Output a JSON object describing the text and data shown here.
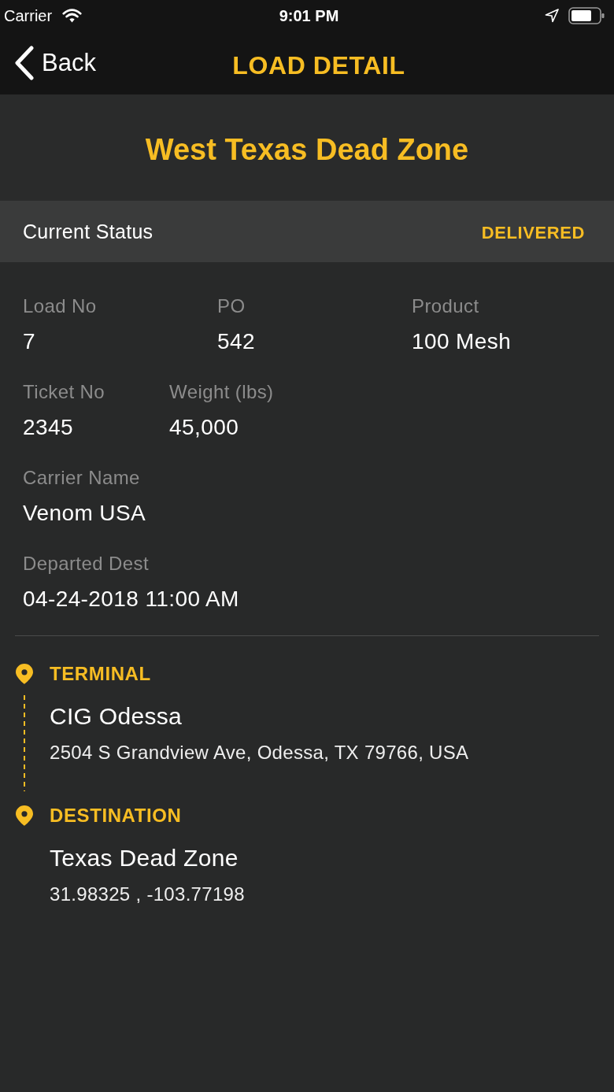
{
  "status_bar": {
    "carrier": "Carrier",
    "time": "9:01 PM"
  },
  "nav_bar": {
    "back": "Back",
    "title": "LOAD DETAIL"
  },
  "header": {
    "title": "West Texas Dead Zone"
  },
  "current_status": {
    "label": "Current Status",
    "value": "DELIVERED"
  },
  "field_rows": [
    {
      "fields": [
        {
          "label": "Load No",
          "value": "7"
        },
        {
          "label": "PO",
          "value": "542"
        },
        {
          "label": "Product",
          "value": "100 Mesh"
        }
      ]
    },
    {
      "fields": [
        {
          "label": "Ticket No",
          "value": "2345"
        },
        {
          "label": "Weight (lbs)",
          "value": "45,000"
        }
      ]
    },
    {
      "fields": [
        {
          "label": "Carrier Name",
          "value": "Venom USA"
        }
      ]
    },
    {
      "fields": [
        {
          "label": "Departed Dest",
          "value": "04-24-2018 11:00 AM"
        }
      ]
    }
  ],
  "stops": [
    {
      "heading": "TERMINAL",
      "name": "CIG Odessa",
      "address": "2504 S Grandview Ave, Odessa, TX 79766, USA"
    },
    {
      "heading": "DESTINATION",
      "name": "Texas Dead Zone",
      "coordinates": "31.98325 , -103.77198"
    }
  ]
}
